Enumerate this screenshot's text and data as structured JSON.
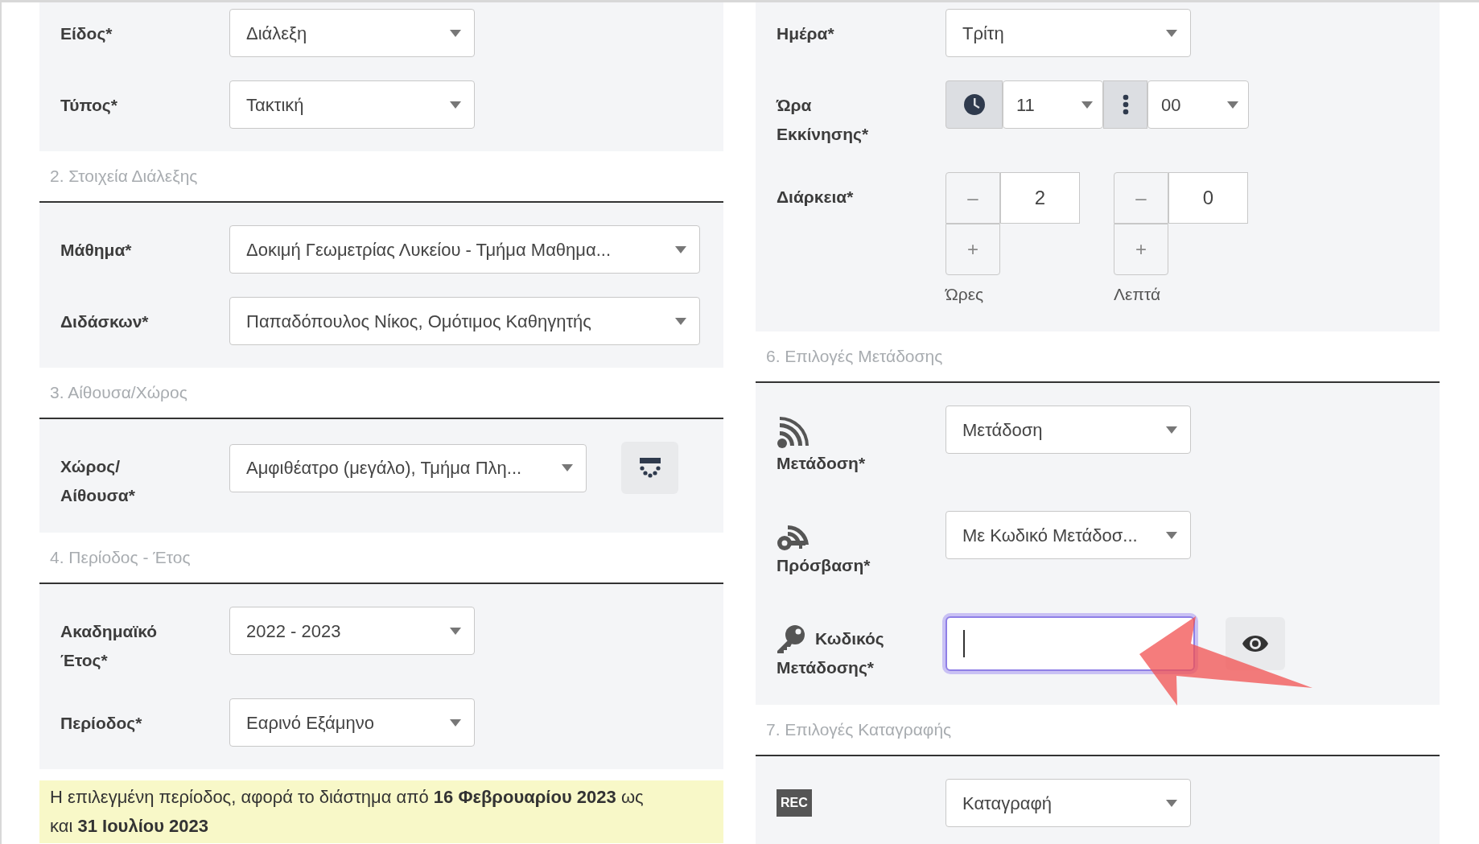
{
  "columns": [
    {
      "sections": [
        {
          "fields": [
            {
              "kind": "select",
              "label_lines": [
                "Είδος*"
              ],
              "value": "Διάλεξη"
            },
            {
              "kind": "select",
              "label_lines": [
                "Τύπος*"
              ],
              "value": "Τακτική"
            }
          ]
        },
        {
          "title": "2. Στοιχεία Διάλεξης",
          "fields": [
            {
              "kind": "select_wide",
              "label_lines": [
                "Μάθημα*"
              ],
              "value": "Δοκιμή Γεωμετρίας Λυκείου - Τμήμα Μαθημα..."
            },
            {
              "kind": "select_wide",
              "label_lines": [
                "Διδάσκων*"
              ],
              "value": "Παπαδόπουλος Νίκος, Ομότιμος Καθηγητής"
            }
          ]
        },
        {
          "title": "3. Αίθουσα/Χώρος",
          "fields": [
            {
              "kind": "select_button",
              "label_lines": [
                "Χώρος/",
                "Αίθουσα*"
              ],
              "value": "Αμφιθέατρο (μεγάλο), Τμήμα Πλη..."
            }
          ]
        },
        {
          "title": "4. Περίοδος - Έτος",
          "fields": [
            {
              "kind": "select",
              "label_lines": [
                "Ακαδημαϊκό",
                "Έτος*"
              ],
              "value": "2022 - 2023"
            },
            {
              "kind": "select",
              "label_lines": [
                "Περίοδος*"
              ],
              "value": "Εαρινό Εξάμηνο"
            }
          ]
        }
      ],
      "note": "Η επιλεγμένη περίοδος, αφορά το διάστημα από **16 Φεβρουαρίου 2023** ως και **31 Ιουλίου 2023**"
    },
    {
      "sections": [
        {
          "fields": [
            {
              "kind": "select",
              "label_lines": [
                "Ημέρα*"
              ],
              "value": "Τρίτη"
            },
            {
              "kind": "time",
              "label_lines": [
                "Ώρα",
                "Εκκίνησης*"
              ],
              "hour": "11",
              "minute": "00"
            },
            {
              "kind": "duration",
              "label_lines": [
                "Διάρκεια*"
              ],
              "groups": [
                {
                  "minus": "–",
                  "value": "2",
                  "plus": "+",
                  "caption": "Ώρες"
                },
                {
                  "minus": "–",
                  "value": "0",
                  "plus": "+",
                  "caption": "Λεπτά"
                }
              ]
            }
          ]
        },
        {
          "title": "6. Επιλογές Μετάδοσης",
          "fields": [
            {
              "kind": "stream_select",
              "label_lines": [
                "Μετάδοση*"
              ],
              "value": "Μετάδοση"
            },
            {
              "kind": "access_select",
              "label_lines": [
                "Πρόσβαση*"
              ],
              "value": "Με Κωδικό Μετάδοσ..."
            },
            {
              "kind": "password",
              "label_lines": [
                "Κωδικός",
                "Μετάδοσης*"
              ],
              "focused": true
            }
          ]
        },
        {
          "title": "7. Επιλογές Καταγραφής",
          "fields": [
            {
              "kind": "record_select",
              "label_badge": "REC",
              "value": "Καταγραφή"
            }
          ]
        }
      ]
    }
  ]
}
